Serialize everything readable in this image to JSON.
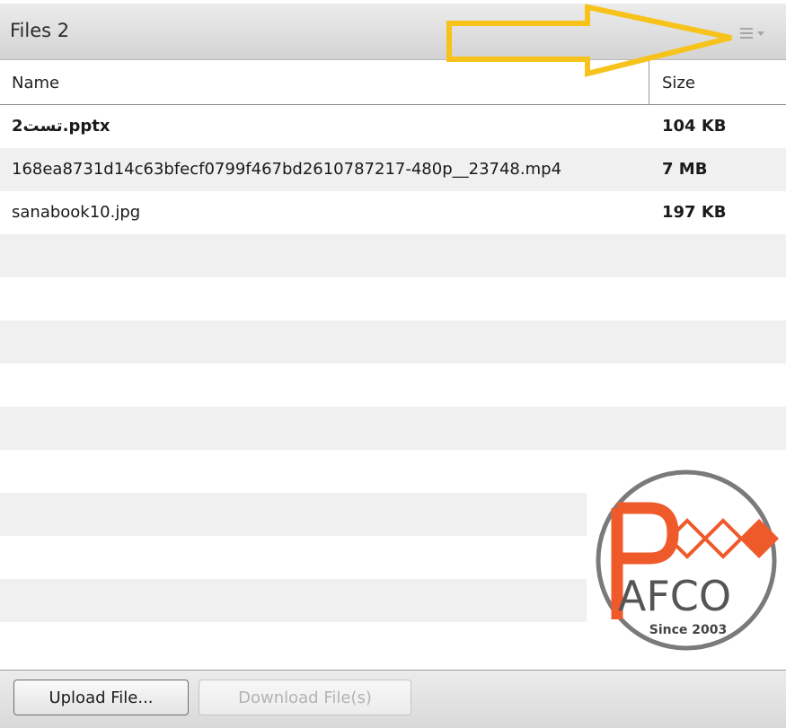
{
  "panel": {
    "title": "Files 2",
    "menu_icon": "hamburger-menu-icon"
  },
  "table": {
    "columns": [
      "Name",
      "Size"
    ],
    "rows": [
      {
        "name": "2تست.pptx",
        "size": "104 KB"
      },
      {
        "name": "168ea8731d14c63bfecf0799f467bd2610787217-480p__23748.mp4",
        "size": "7 MB"
      },
      {
        "name": "sanabook10.jpg",
        "size": "197 KB"
      }
    ]
  },
  "footer": {
    "upload_label": "Upload File...",
    "download_label": "Download File(s)"
  },
  "logo": {
    "brand": "AFCO",
    "since": "Since 2003"
  },
  "colors": {
    "annotation_arrow": "#f7c21a",
    "logo_orange": "#ef5a2b",
    "logo_ring": "#7a7a7a"
  }
}
